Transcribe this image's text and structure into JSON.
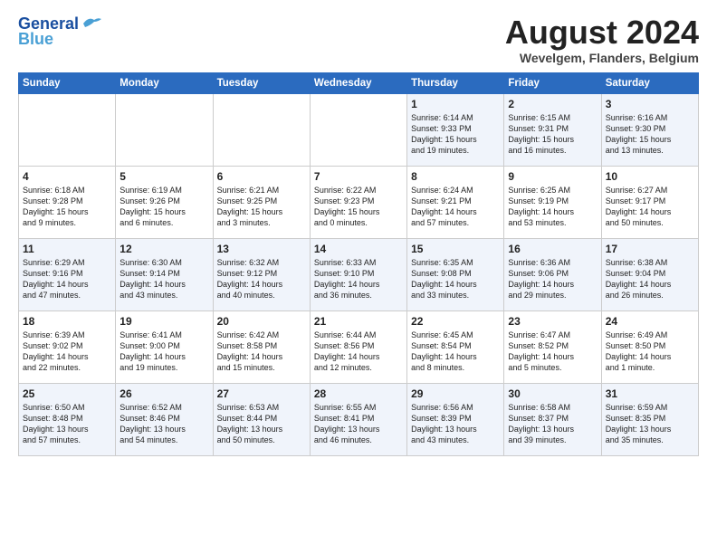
{
  "header": {
    "logo_line1": "General",
    "logo_line2": "Blue",
    "month_title": "August 2024",
    "location": "Wevelgem, Flanders, Belgium"
  },
  "weekdays": [
    "Sunday",
    "Monday",
    "Tuesday",
    "Wednesday",
    "Thursday",
    "Friday",
    "Saturday"
  ],
  "weeks": [
    [
      {
        "day": "",
        "info": ""
      },
      {
        "day": "",
        "info": ""
      },
      {
        "day": "",
        "info": ""
      },
      {
        "day": "",
        "info": ""
      },
      {
        "day": "1",
        "info": "Sunrise: 6:14 AM\nSunset: 9:33 PM\nDaylight: 15 hours\nand 19 minutes."
      },
      {
        "day": "2",
        "info": "Sunrise: 6:15 AM\nSunset: 9:31 PM\nDaylight: 15 hours\nand 16 minutes."
      },
      {
        "day": "3",
        "info": "Sunrise: 6:16 AM\nSunset: 9:30 PM\nDaylight: 15 hours\nand 13 minutes."
      }
    ],
    [
      {
        "day": "4",
        "info": "Sunrise: 6:18 AM\nSunset: 9:28 PM\nDaylight: 15 hours\nand 9 minutes."
      },
      {
        "day": "5",
        "info": "Sunrise: 6:19 AM\nSunset: 9:26 PM\nDaylight: 15 hours\nand 6 minutes."
      },
      {
        "day": "6",
        "info": "Sunrise: 6:21 AM\nSunset: 9:25 PM\nDaylight: 15 hours\nand 3 minutes."
      },
      {
        "day": "7",
        "info": "Sunrise: 6:22 AM\nSunset: 9:23 PM\nDaylight: 15 hours\nand 0 minutes."
      },
      {
        "day": "8",
        "info": "Sunrise: 6:24 AM\nSunset: 9:21 PM\nDaylight: 14 hours\nand 57 minutes."
      },
      {
        "day": "9",
        "info": "Sunrise: 6:25 AM\nSunset: 9:19 PM\nDaylight: 14 hours\nand 53 minutes."
      },
      {
        "day": "10",
        "info": "Sunrise: 6:27 AM\nSunset: 9:17 PM\nDaylight: 14 hours\nand 50 minutes."
      }
    ],
    [
      {
        "day": "11",
        "info": "Sunrise: 6:29 AM\nSunset: 9:16 PM\nDaylight: 14 hours\nand 47 minutes."
      },
      {
        "day": "12",
        "info": "Sunrise: 6:30 AM\nSunset: 9:14 PM\nDaylight: 14 hours\nand 43 minutes."
      },
      {
        "day": "13",
        "info": "Sunrise: 6:32 AM\nSunset: 9:12 PM\nDaylight: 14 hours\nand 40 minutes."
      },
      {
        "day": "14",
        "info": "Sunrise: 6:33 AM\nSunset: 9:10 PM\nDaylight: 14 hours\nand 36 minutes."
      },
      {
        "day": "15",
        "info": "Sunrise: 6:35 AM\nSunset: 9:08 PM\nDaylight: 14 hours\nand 33 minutes."
      },
      {
        "day": "16",
        "info": "Sunrise: 6:36 AM\nSunset: 9:06 PM\nDaylight: 14 hours\nand 29 minutes."
      },
      {
        "day": "17",
        "info": "Sunrise: 6:38 AM\nSunset: 9:04 PM\nDaylight: 14 hours\nand 26 minutes."
      }
    ],
    [
      {
        "day": "18",
        "info": "Sunrise: 6:39 AM\nSunset: 9:02 PM\nDaylight: 14 hours\nand 22 minutes."
      },
      {
        "day": "19",
        "info": "Sunrise: 6:41 AM\nSunset: 9:00 PM\nDaylight: 14 hours\nand 19 minutes."
      },
      {
        "day": "20",
        "info": "Sunrise: 6:42 AM\nSunset: 8:58 PM\nDaylight: 14 hours\nand 15 minutes."
      },
      {
        "day": "21",
        "info": "Sunrise: 6:44 AM\nSunset: 8:56 PM\nDaylight: 14 hours\nand 12 minutes."
      },
      {
        "day": "22",
        "info": "Sunrise: 6:45 AM\nSunset: 8:54 PM\nDaylight: 14 hours\nand 8 minutes."
      },
      {
        "day": "23",
        "info": "Sunrise: 6:47 AM\nSunset: 8:52 PM\nDaylight: 14 hours\nand 5 minutes."
      },
      {
        "day": "24",
        "info": "Sunrise: 6:49 AM\nSunset: 8:50 PM\nDaylight: 14 hours\nand 1 minute."
      }
    ],
    [
      {
        "day": "25",
        "info": "Sunrise: 6:50 AM\nSunset: 8:48 PM\nDaylight: 13 hours\nand 57 minutes."
      },
      {
        "day": "26",
        "info": "Sunrise: 6:52 AM\nSunset: 8:46 PM\nDaylight: 13 hours\nand 54 minutes."
      },
      {
        "day": "27",
        "info": "Sunrise: 6:53 AM\nSunset: 8:44 PM\nDaylight: 13 hours\nand 50 minutes."
      },
      {
        "day": "28",
        "info": "Sunrise: 6:55 AM\nSunset: 8:41 PM\nDaylight: 13 hours\nand 46 minutes."
      },
      {
        "day": "29",
        "info": "Sunrise: 6:56 AM\nSunset: 8:39 PM\nDaylight: 13 hours\nand 43 minutes."
      },
      {
        "day": "30",
        "info": "Sunrise: 6:58 AM\nSunset: 8:37 PM\nDaylight: 13 hours\nand 39 minutes."
      },
      {
        "day": "31",
        "info": "Sunrise: 6:59 AM\nSunset: 8:35 PM\nDaylight: 13 hours\nand 35 minutes."
      }
    ]
  ]
}
